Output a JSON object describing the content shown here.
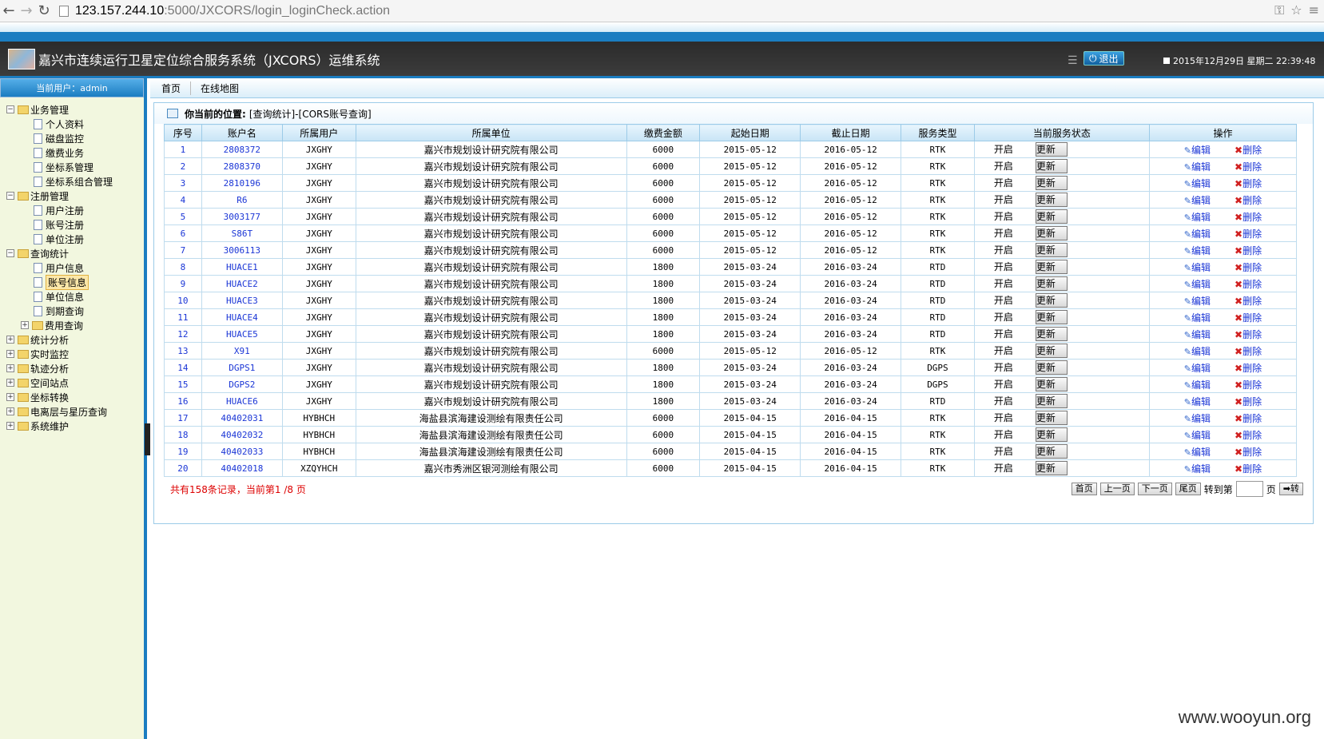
{
  "browser": {
    "url_host": "123.157.244.10",
    "url_rest": ":5000/JXCORS/login_loginCheck.action"
  },
  "header": {
    "title": "嘉兴市连续运行卫星定位综合服务系统（JXCORS）运维系统",
    "logout_label": "退出",
    "datetime": "2015年12月29日 星期二 22:39:48"
  },
  "sidebar": {
    "current_user": "当前用户：admin",
    "groups": [
      {
        "label": "业务管理",
        "toggle": "−",
        "items": [
          "个人资料",
          "磁盘监控",
          "缴费业务",
          "坐标系管理",
          "坐标系组合管理"
        ]
      },
      {
        "label": "注册管理",
        "toggle": "−",
        "items": [
          "用户注册",
          "账号注册",
          "单位注册"
        ]
      },
      {
        "label": "查询统计",
        "toggle": "−",
        "items": [
          "用户信息",
          "账号信息",
          "单位信息",
          "到期查询",
          "费用查询"
        ]
      },
      {
        "label": "统计分析",
        "toggle": "+"
      },
      {
        "label": "实时监控",
        "toggle": "+"
      },
      {
        "label": "轨迹分析",
        "toggle": "+"
      },
      {
        "label": "空间站点",
        "toggle": "+"
      },
      {
        "label": "坐标转换",
        "toggle": "+"
      },
      {
        "label": "电离层与星历查询",
        "toggle": "+"
      },
      {
        "label": "系统维护",
        "toggle": "+"
      }
    ]
  },
  "tabs": [
    "首页",
    "在线地图"
  ],
  "breadcrumb": {
    "label": "你当前的位置:",
    "path": "[查询统计]-[CORS账号查询]"
  },
  "table": {
    "headers": [
      "序号",
      "账户名",
      "所属用户",
      "所属单位",
      "缴费金额",
      "起始日期",
      "截止日期",
      "服务类型",
      "当前服务状态",
      "操作"
    ],
    "status_label": "开启",
    "update_label": "更新",
    "edit_label": "编辑",
    "delete_label": "删除",
    "rows": [
      [
        "1",
        "2808372",
        "JXGHY",
        "嘉兴市规划设计研究院有限公司",
        "6000",
        "2015-05-12",
        "2016-05-12",
        "RTK"
      ],
      [
        "2",
        "2808370",
        "JXGHY",
        "嘉兴市规划设计研究院有限公司",
        "6000",
        "2015-05-12",
        "2016-05-12",
        "RTK"
      ],
      [
        "3",
        "2810196",
        "JXGHY",
        "嘉兴市规划设计研究院有限公司",
        "6000",
        "2015-05-12",
        "2016-05-12",
        "RTK"
      ],
      [
        "4",
        "R6",
        "JXGHY",
        "嘉兴市规划设计研究院有限公司",
        "6000",
        "2015-05-12",
        "2016-05-12",
        "RTK"
      ],
      [
        "5",
        "3003177",
        "JXGHY",
        "嘉兴市规划设计研究院有限公司",
        "6000",
        "2015-05-12",
        "2016-05-12",
        "RTK"
      ],
      [
        "6",
        "S86T",
        "JXGHY",
        "嘉兴市规划设计研究院有限公司",
        "6000",
        "2015-05-12",
        "2016-05-12",
        "RTK"
      ],
      [
        "7",
        "3006113",
        "JXGHY",
        "嘉兴市规划设计研究院有限公司",
        "6000",
        "2015-05-12",
        "2016-05-12",
        "RTK"
      ],
      [
        "8",
        "HUACE1",
        "JXGHY",
        "嘉兴市规划设计研究院有限公司",
        "1800",
        "2015-03-24",
        "2016-03-24",
        "RTD"
      ],
      [
        "9",
        "HUACE2",
        "JXGHY",
        "嘉兴市规划设计研究院有限公司",
        "1800",
        "2015-03-24",
        "2016-03-24",
        "RTD"
      ],
      [
        "10",
        "HUACE3",
        "JXGHY",
        "嘉兴市规划设计研究院有限公司",
        "1800",
        "2015-03-24",
        "2016-03-24",
        "RTD"
      ],
      [
        "11",
        "HUACE4",
        "JXGHY",
        "嘉兴市规划设计研究院有限公司",
        "1800",
        "2015-03-24",
        "2016-03-24",
        "RTD"
      ],
      [
        "12",
        "HUACE5",
        "JXGHY",
        "嘉兴市规划设计研究院有限公司",
        "1800",
        "2015-03-24",
        "2016-03-24",
        "RTD"
      ],
      [
        "13",
        "X91",
        "JXGHY",
        "嘉兴市规划设计研究院有限公司",
        "6000",
        "2015-05-12",
        "2016-05-12",
        "RTK"
      ],
      [
        "14",
        "DGPS1",
        "JXGHY",
        "嘉兴市规划设计研究院有限公司",
        "1800",
        "2015-03-24",
        "2016-03-24",
        "DGPS"
      ],
      [
        "15",
        "DGPS2",
        "JXGHY",
        "嘉兴市规划设计研究院有限公司",
        "1800",
        "2015-03-24",
        "2016-03-24",
        "DGPS"
      ],
      [
        "16",
        "HUACE6",
        "JXGHY",
        "嘉兴市规划设计研究院有限公司",
        "1800",
        "2015-03-24",
        "2016-03-24",
        "RTD"
      ],
      [
        "17",
        "40402031",
        "HYBHCH",
        "海盐县滨海建设测绘有限责任公司",
        "6000",
        "2015-04-15",
        "2016-04-15",
        "RTK"
      ],
      [
        "18",
        "40402032",
        "HYBHCH",
        "海盐县滨海建设测绘有限责任公司",
        "6000",
        "2015-04-15",
        "2016-04-15",
        "RTK"
      ],
      [
        "19",
        "40402033",
        "HYBHCH",
        "海盐县滨海建设测绘有限责任公司",
        "6000",
        "2015-04-15",
        "2016-04-15",
        "RTK"
      ],
      [
        "20",
        "40402018",
        "XZQYHCH",
        "嘉兴市秀洲区银河测绘有限公司",
        "6000",
        "2015-04-15",
        "2016-04-15",
        "RTK"
      ]
    ]
  },
  "pager": {
    "info": "共有158条记录，当前第1 /8 页",
    "first": "首页",
    "prev": "上一页",
    "next": "下一页",
    "last": "尾页",
    "goto_label": "转到第",
    "page_unit": "页",
    "go": "➡转"
  },
  "watermark": "www.wooyun.org"
}
